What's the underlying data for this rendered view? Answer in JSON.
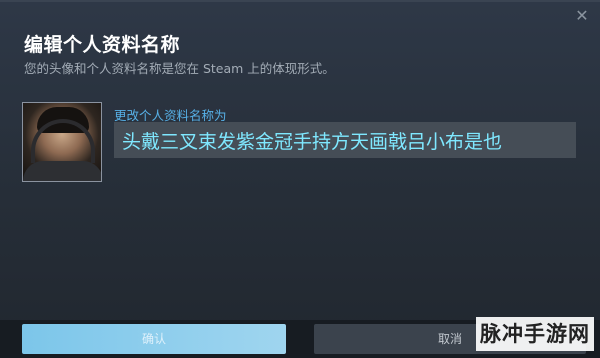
{
  "dialog": {
    "title": "编辑个人资料名称",
    "subtitle": "您的头像和个人资料名称是您在 Steam 上的体现形式。",
    "close_glyph": "✕"
  },
  "profile": {
    "field_label": "更改个人资料名称为",
    "name_value": "头戴三叉束发紫金冠手持方天画戟吕小布是也"
  },
  "buttons": {
    "confirm_label": "确认",
    "cancel_label": "取消"
  },
  "watermark": {
    "text": "脉冲手游网"
  },
  "colors": {
    "accent": "#57b0e6",
    "input_text": "#7fe8ff",
    "confirm_button": "#7cc6ea"
  }
}
